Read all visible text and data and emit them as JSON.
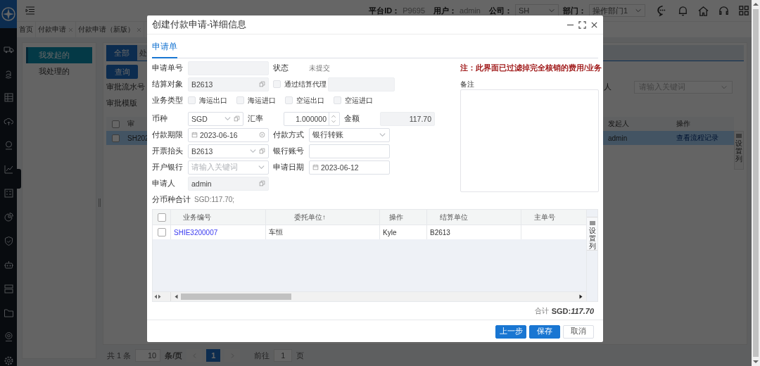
{
  "topbar": {
    "platform_label": "平台ID：",
    "platform_id": "P9695",
    "user_label": "用户：",
    "user": "admin",
    "company_label": "公司：",
    "company": "SH",
    "dept_label": "部门：",
    "dept": "操作部门1"
  },
  "page_tabs": [
    {
      "label": "首页",
      "closable": false
    },
    {
      "label": "付款申请",
      "closable": true
    },
    {
      "label": "付款申请（新版）",
      "closable": true
    }
  ],
  "side_menu": [
    {
      "label": "我发起的",
      "selected": true
    },
    {
      "label": "我处理的",
      "selected": false
    }
  ],
  "main": {
    "tabs": [
      {
        "label": "全部",
        "selected": true
      },
      {
        "label": "处",
        "selected": false
      }
    ],
    "query_button": "查询",
    "filters": [
      {
        "label": "审批流水号"
      },
      {
        "label": "审批模版"
      }
    ],
    "right_filter": {
      "label": "人",
      "placeholder": "请输入关键词"
    },
    "table": {
      "all_checked": false,
      "columns": [
        {
          "label": "审"
        },
        {
          "label": "发起人"
        },
        {
          "label": "操作"
        }
      ],
      "rows": [
        {
          "selected": true,
          "checked": false,
          "cells": [
            {
              "kind": "text",
              "text": "SH202"
            },
            {
              "kind": "text",
              "text": "admin"
            },
            {
              "kind": "link",
              "text": "查看流程记录"
            }
          ]
        }
      ],
      "settings_label": "设置列"
    },
    "pagination": {
      "total": "共 1 条",
      "page_size": "10",
      "page_size_unit": "条/页",
      "pages": [
        {
          "label": "1",
          "selected": true
        }
      ],
      "goto_label": "前往",
      "goto_value": "1",
      "page_unit": "页"
    }
  },
  "dialog": {
    "title": "创建付款申请-详细信息",
    "tabs": [
      {
        "label": "申请单",
        "selected": true
      }
    ],
    "form_rows": [
      {
        "kind": "pair",
        "items": [
          {
            "kind": "label",
            "text": "申请单号"
          },
          {
            "kind": "text",
            "disabled": true
          },
          {
            "kind": "label",
            "text": "状态"
          },
          {
            "kind": "static",
            "text": "未提交"
          }
        ]
      },
      {
        "kind": "agent",
        "items": [
          {
            "kind": "label",
            "text": "结算对象"
          },
          {
            "kind": "text",
            "value": "B2613",
            "disabled": true,
            "copyable": true
          },
          {
            "kind": "checkbox",
            "label": "通过结算代理",
            "checked": false
          },
          {
            "kind": "text",
            "disabled": true
          }
        ]
      },
      {
        "kind": "checks",
        "items": [
          {
            "kind": "label",
            "text": "业务类型"
          },
          {
            "kind": "checkbox",
            "label": "海运出口",
            "checked": false
          },
          {
            "kind": "checkbox",
            "label": "海运进口",
            "checked": false
          },
          {
            "kind": "checkbox",
            "label": "空运出口",
            "checked": false
          },
          {
            "kind": "checkbox",
            "label": "空运进口",
            "checked": false
          }
        ]
      },
      {
        "kind": "triple",
        "items": [
          {
            "kind": "label",
            "text": "币种"
          },
          {
            "kind": "select",
            "value": "SGD",
            "copyable": true
          },
          {
            "kind": "label",
            "text": "汇率"
          },
          {
            "kind": "number",
            "value": "1.000000"
          },
          {
            "kind": "label",
            "text": "金额"
          },
          {
            "kind": "amount",
            "value": "117.70",
            "disabled": true
          }
        ]
      },
      {
        "kind": "pair",
        "items": [
          {
            "kind": "label",
            "text": "付款期限"
          },
          {
            "kind": "date",
            "value": "2023-06-16",
            "clearable": true
          },
          {
            "kind": "label",
            "text": "付款方式"
          },
          {
            "kind": "select",
            "value": "银行转账"
          }
        ]
      },
      {
        "kind": "pair",
        "items": [
          {
            "kind": "label",
            "text": "开票抬头"
          },
          {
            "kind": "select",
            "value": "B2613",
            "copyable": true
          },
          {
            "kind": "label",
            "text": "银行账号"
          },
          {
            "kind": "text"
          }
        ]
      },
      {
        "kind": "pair",
        "items": [
          {
            "kind": "label",
            "text": "开户银行"
          },
          {
            "kind": "select",
            "placeholder": "请输入关键词"
          },
          {
            "kind": "label",
            "text": "申请日期"
          },
          {
            "kind": "date",
            "value": "2023-06-12"
          }
        ]
      },
      {
        "kind": "single",
        "items": [
          {
            "kind": "label",
            "text": "申请人"
          },
          {
            "kind": "text",
            "value": "admin",
            "disabled": true,
            "copyable": true
          }
        ]
      },
      {
        "kind": "summary",
        "items": [
          {
            "kind": "label",
            "text": "分币种合计"
          },
          {
            "kind": "static",
            "text": "SGD:117.70;"
          }
        ]
      }
    ],
    "notice": "注：此界面已过滤掉完全核销的费用/业务",
    "remarks": {
      "label": "备注"
    },
    "table": {
      "all_checked": false,
      "columns": [
        {
          "label": "业务编号"
        },
        {
          "label": "委托单位↑"
        },
        {
          "label": "操作"
        },
        {
          "label": "结算单位"
        },
        {
          "label": "主单号"
        }
      ],
      "rows": [
        {
          "checked": false,
          "cells": [
            {
              "kind": "link",
              "text": "SHIE3200007"
            },
            {
              "kind": "text",
              "text": "车恒"
            },
            {
              "kind": "text",
              "text": "Kyle"
            },
            {
              "kind": "text",
              "text": "B2613"
            }
          ]
        }
      ],
      "settings_label": "设置列"
    },
    "total": {
      "label": "合计",
      "value": "SGD:*117.70*"
    },
    "buttons": [
      {
        "label": "上一步",
        "kind": "primary"
      },
      {
        "label": "保存",
        "kind": "primary"
      },
      {
        "label": "取消",
        "kind": "default"
      }
    ]
  }
}
